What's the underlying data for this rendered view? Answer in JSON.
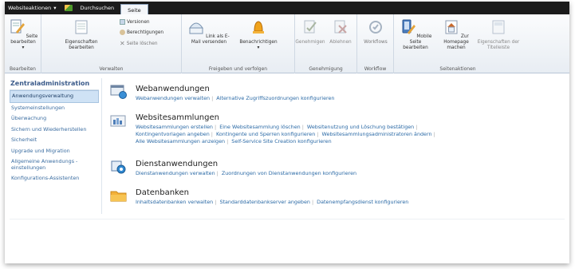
{
  "topbar": {
    "site_actions": "Websiteaktionen",
    "browse_tab": "Durchsuchen",
    "page_tab": "Seite"
  },
  "ribbon": {
    "edit_page": "Seite bearbeiten",
    "properties": "Eigenschaften bearbeiten",
    "versions": "Versionen",
    "permissions": "Berechtigungen",
    "delete_page": "Seite löschen",
    "email_link": "Link als E-Mail versenden",
    "alerts": "Benachrichtigen",
    "approve": "Genehmigen",
    "reject": "Ablehnen",
    "workflows": "Workflows",
    "mobile_page": "Mobile Seite bearbeiten",
    "make_homepage": "Zur Homepage machen",
    "title_bar_properties": "Eigenschaften der Titelleiste",
    "group_edit": "Bearbeiten",
    "group_manage": "Verwalten",
    "group_share": "Freigeben und verfolgen",
    "group_approval": "Genehmigung",
    "group_workflow": "Workflow",
    "group_page_actions": "Seitenaktionen"
  },
  "sidebar": {
    "heading": "Zentraladministration",
    "items": [
      "Anwendungsverwaltung",
      "Systemeinstellungen",
      "Überwachung",
      "Sichern und Wiederherstellen",
      "Sicherheit",
      "Upgrade und Migration",
      "Allgemeine Anwendungs -einstellungen",
      "Konfigurations-Assistenten"
    ]
  },
  "sections": {
    "web": {
      "title": "Webanwendungen",
      "links": [
        "Webanwendungen verwalten",
        "Alternative Zugriffszuordnungen konfigurieren"
      ]
    },
    "sites": {
      "title": "Websitesammlungen",
      "links": [
        "Websitesammlungen erstellen",
        "Eine Websitesammlung löschen",
        "Websitenutzung und Löschung bestätigen",
        "Kontingentvorlagen angeben",
        "Kontingente und Sperren konfigurieren",
        "Websitesammlungsadministratoren ändern",
        "Alle Websitesammlungen anzeigen",
        "Self-Service Site Creation konfigurieren"
      ]
    },
    "services": {
      "title": "Dienstanwendungen",
      "links": [
        "Dienstanwendungen verwalten",
        "Zuordnungen von Dienstanwendungen konfigurieren"
      ]
    },
    "db": {
      "title": "Datenbanken",
      "links": [
        "Inhaltsdatenbanken verwalten",
        "Standarddatenbankserver angeben",
        "Datenempfangsdienst konfigurieren"
      ]
    }
  },
  "colors": {
    "link": "#2b6aa6",
    "heading": "#3a5a8a",
    "selected_bg": "#cfe2f5",
    "topbar": "#1b1b1b"
  }
}
